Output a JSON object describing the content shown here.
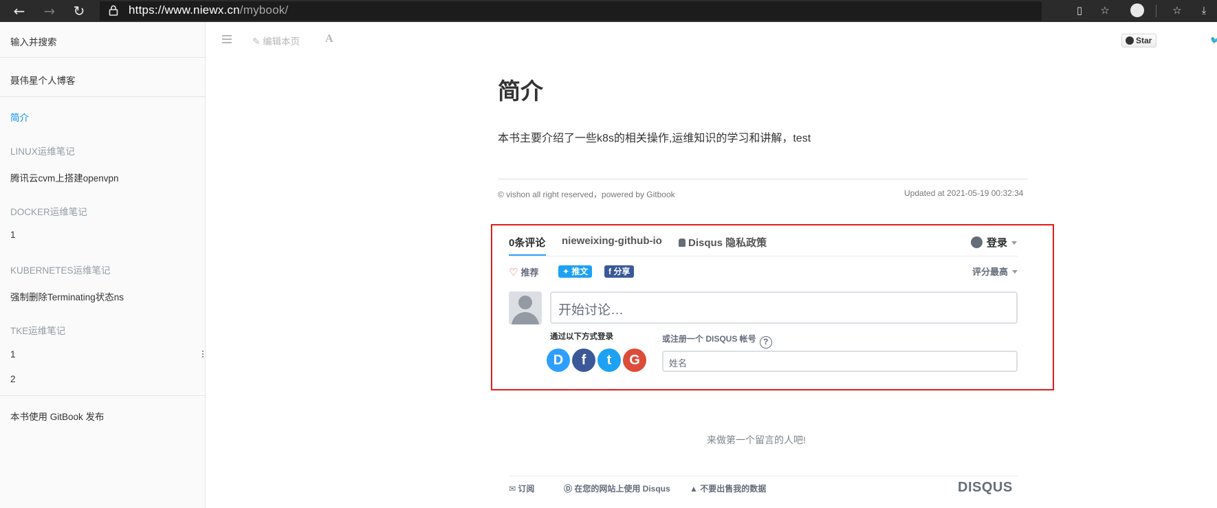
{
  "browser": {
    "url_host": "https://www.niewx.cn",
    "url_path": "/mybook/"
  },
  "sidebar": {
    "search_placeholder": "输入并搜索",
    "blog_link": "聂伟星个人博客",
    "items": [
      {
        "label": "简介",
        "type": "item",
        "active": true
      },
      {
        "label": "LINUX运维笔记",
        "type": "header"
      },
      {
        "label": "腾讯云cvm上搭建openvpn",
        "type": "item"
      },
      {
        "label": "DOCKER运维笔记",
        "type": "header"
      },
      {
        "label": "1",
        "type": "item"
      },
      {
        "label": "KUBERNETES运维笔记",
        "type": "header"
      },
      {
        "label": "强制删除Terminating状态ns",
        "type": "item"
      },
      {
        "label": "TKE运维笔记",
        "type": "header"
      },
      {
        "label": "1",
        "type": "item"
      },
      {
        "label": "2",
        "type": "item"
      }
    ],
    "published_with": "本书使用 GitBook 发布"
  },
  "toolbar": {
    "edit_label": "编辑本页",
    "font_label": "A",
    "star_label": "Star"
  },
  "page": {
    "title": "简介",
    "intro": "本书主要介绍了一些k8s的相关操作,运维知识的学习和讲解，test",
    "footer_left": "© vishon all right reserved，powered by Gitbook",
    "footer_right": "Updated at 2021-05-19 00:32:34"
  },
  "disqus": {
    "tabs": [
      "0条评论",
      "nieweixing-github-io",
      "Disqus 隐私政策"
    ],
    "login_label": "登录",
    "recommend_label": "推荐",
    "tweet_label": "推文",
    "share_label": "分享",
    "sort_label": "评分最高",
    "comment_placeholder": "开始讨论…",
    "login_with_label": "通过以下方式登录",
    "register_label": "或注册一个 DISQUS 帐号",
    "help_label": "?",
    "name_placeholder": "姓名",
    "social": [
      {
        "label": "D",
        "color": "#2e9fff"
      },
      {
        "label": "f",
        "color": "#3b5998"
      },
      {
        "label": "t",
        "color": "#1da1f2"
      },
      {
        "label": "G",
        "color": "#dd4b39"
      }
    ],
    "first_comment": "来做第一个留言的人吧!",
    "footer": {
      "subscribe": "订阅",
      "use_on_site": "在您的网站上使用 Disqus",
      "do_not_sell": "不要出售我的数据",
      "logo": "DISQUS"
    }
  },
  "colors": {
    "highlight_border": "#e21a1a",
    "sidebar_active": "#008cff"
  }
}
